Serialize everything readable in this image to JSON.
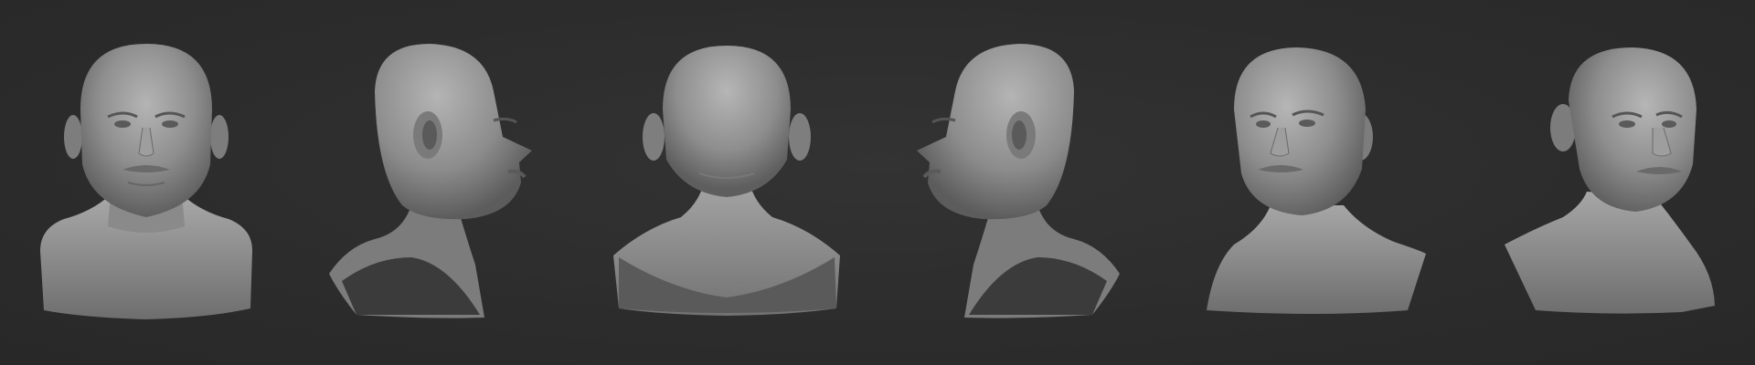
{
  "scene": {
    "background_color": "#2d2d2d",
    "sculpt_color": "#9a9a9a",
    "views": [
      {
        "id": "front",
        "angle": "front"
      },
      {
        "id": "right-profile",
        "angle": "three-quarter-back-right"
      },
      {
        "id": "back",
        "angle": "back"
      },
      {
        "id": "left-profile",
        "angle": "three-quarter-back-left"
      },
      {
        "id": "front-three-quarter-left",
        "angle": "three-quarter-front-left"
      },
      {
        "id": "front-three-quarter-right",
        "angle": "three-quarter-front-right"
      }
    ]
  }
}
